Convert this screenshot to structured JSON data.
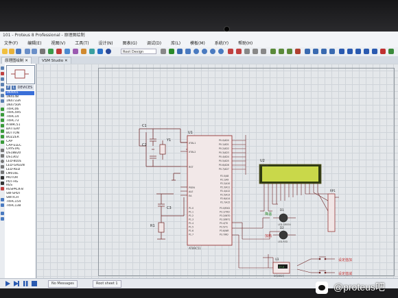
{
  "window": {
    "title": "101 - Proteus 8 Professional - 原理图绘制"
  },
  "menu": [
    "文件(F)",
    "编辑(E)",
    "视图(V)",
    "工具(T)",
    "设计(N)",
    "图表(G)",
    "调试(D)",
    "库(L)",
    "模板(M)",
    "系统(Y)",
    "帮助(H)"
  ],
  "toolbar": {
    "design_select": "Root Design"
  },
  "tabs": [
    {
      "label": "原理图绘制"
    },
    {
      "label": "VSM Studio"
    }
  ],
  "panel": {
    "header_p": "P",
    "header_l": "L",
    "header_label": "DEVICES",
    "devices": [
      "1N4001",
      "1N4148",
      "1N4733A",
      "1N4750A",
      "74HC06",
      "74HC595",
      "74HC14",
      "74HC73",
      "AT89C51",
      "BATTERY",
      "BUTTON",
      "BUZZER",
      "CAP",
      "CAP-ELEC",
      "CRYSTAL",
      "DS18B20",
      "DS1302",
      "LED-BLUE",
      "LED-GREEN",
      "LED-RED",
      "LM016L",
      "MOTOR",
      "POT-HG",
      "RES",
      "RESPACK-8",
      "SW-SPDT",
      "SWITCH",
      "74HC154",
      "74HC138"
    ],
    "selected_index": 0
  },
  "schematic": {
    "c1_label": "C1",
    "c2_label": "C2",
    "c3_label": "C3",
    "y1_label": "Y1",
    "r1_label": "R1",
    "u1_label": "U1",
    "u2_label": "U2",
    "u3_label": "U3",
    "d1_label": "D1",
    "d2_label": "D2",
    "rp1_label": "RP1",
    "u1_part": "AT89C51",
    "u2_part": "LM016L",
    "pins_left": [
      "XTAL1",
      "XTAL2",
      "RST",
      "PSEN",
      "ALE",
      "EA"
    ],
    "pins_right_top": [
      "P0.0/AD0",
      "P0.1/AD1",
      "P0.2/AD2",
      "P0.3/AD3",
      "P0.4/AD4",
      "P0.5/AD5",
      "P0.6/AD6",
      "P0.7/AD7"
    ],
    "pins_right_mid": [
      "P2.0/A8",
      "P2.1/A9",
      "P2.2/A10",
      "P2.3/A11",
      "P2.4/A12",
      "P2.5/A13",
      "P2.6/A14",
      "P2.7/A15"
    ],
    "pins_right_bot": [
      "P3.0/RXD",
      "P3.1/TXD",
      "P3.2/INT0",
      "P3.3/INT1",
      "P3.4/T0",
      "P3.5/T1",
      "P3.6/WR",
      "P3.7/RD"
    ],
    "pins_left_bot": [
      "P1.0",
      "P1.1",
      "P1.2",
      "P1.3",
      "P1.4",
      "P1.5",
      "P1.6",
      "P1.7"
    ],
    "label_cool": "降温",
    "label_heat": "加热",
    "btn_add_label": "设定值加",
    "btn_sub_label": "设定值减",
    "d1_part": "LED-GREEN",
    "d2_part": "LED-RED",
    "u3_part": "DS18B20",
    "u3_reading": "27.0"
  },
  "bottom": {
    "tab_messages": "No Messages",
    "tab_sheet": "Root sheet 1"
  },
  "watermark": {
    "text": "@proteus吧"
  },
  "colors": {
    "wire": "#6b1e1e",
    "component": "#8a2020",
    "lcd": "#c9d84a",
    "selected": "#3a6fd8"
  }
}
